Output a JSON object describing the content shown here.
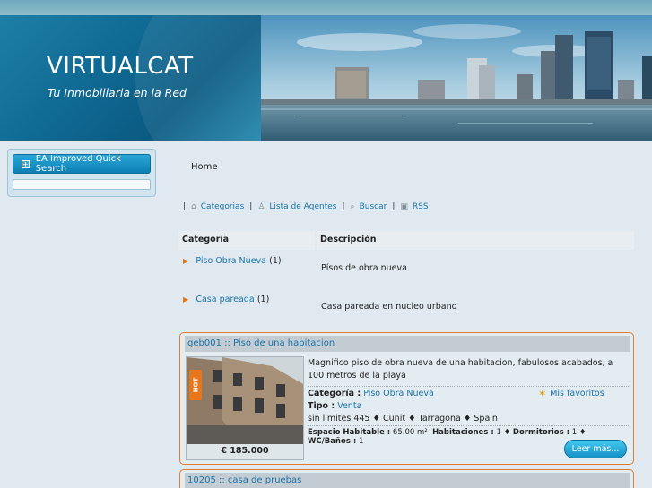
{
  "header": {
    "site_title": "VIRTUALCAT",
    "tagline": "Tu Inmobiliaria en la Red"
  },
  "sidebar": {
    "quick_search_label": "EA Improved Quick Search"
  },
  "breadcrumb": {
    "home": "Home"
  },
  "nav": {
    "items": [
      {
        "label": "Categorias",
        "icon": "home-icon"
      },
      {
        "label": "Lista de Agentes",
        "icon": "user-icon"
      },
      {
        "label": "Buscar",
        "icon": "search-icon"
      },
      {
        "label": "RSS",
        "icon": "rss-icon"
      }
    ],
    "separator": "|"
  },
  "categories": {
    "headers": [
      "Categoría",
      "Descripción"
    ],
    "rows": [
      {
        "name": "Piso Obra Nueva",
        "count": "(1)",
        "description": "Písos de obra nueva"
      },
      {
        "name": "Casa pareada",
        "count": "(1)",
        "description": "Casa pareada en nucleo urbano"
      }
    ]
  },
  "listings": [
    {
      "title": "geb001 :: Piso de una habitacion",
      "price": "€ 185.000",
      "badge": "HOT",
      "description": "Magnifico piso de obra nueva de una habitacion, fabulosos acabados, a 100 metros de la playa",
      "categoria_label": "Categoría :",
      "categoria_value": "Piso Obra Nueva",
      "tipo_label": "Tipo :",
      "tipo_value": "Venta",
      "location": "sin limites 445 ♦ Cunit ♦ Tarragona ♦ Spain",
      "favorites": "Mis favoritos",
      "specs": {
        "espacio_label": "Espacio Habitable :",
        "espacio_value": "65.00 m²",
        "habitaciones_label": "Habitaciones :",
        "habitaciones_value": "1",
        "dormitorios_label": "Dormitorios :",
        "dormitorios_value": "1",
        "banos_label": "WC/Baños :",
        "banos_value": "1"
      },
      "read_more": "Leer más..."
    },
    {
      "title": "10205 :: casa de pruebas"
    }
  ],
  "colors": {
    "accent": "#1c72a8",
    "listing_border": "#e27c2e",
    "button": "#1590c6"
  }
}
